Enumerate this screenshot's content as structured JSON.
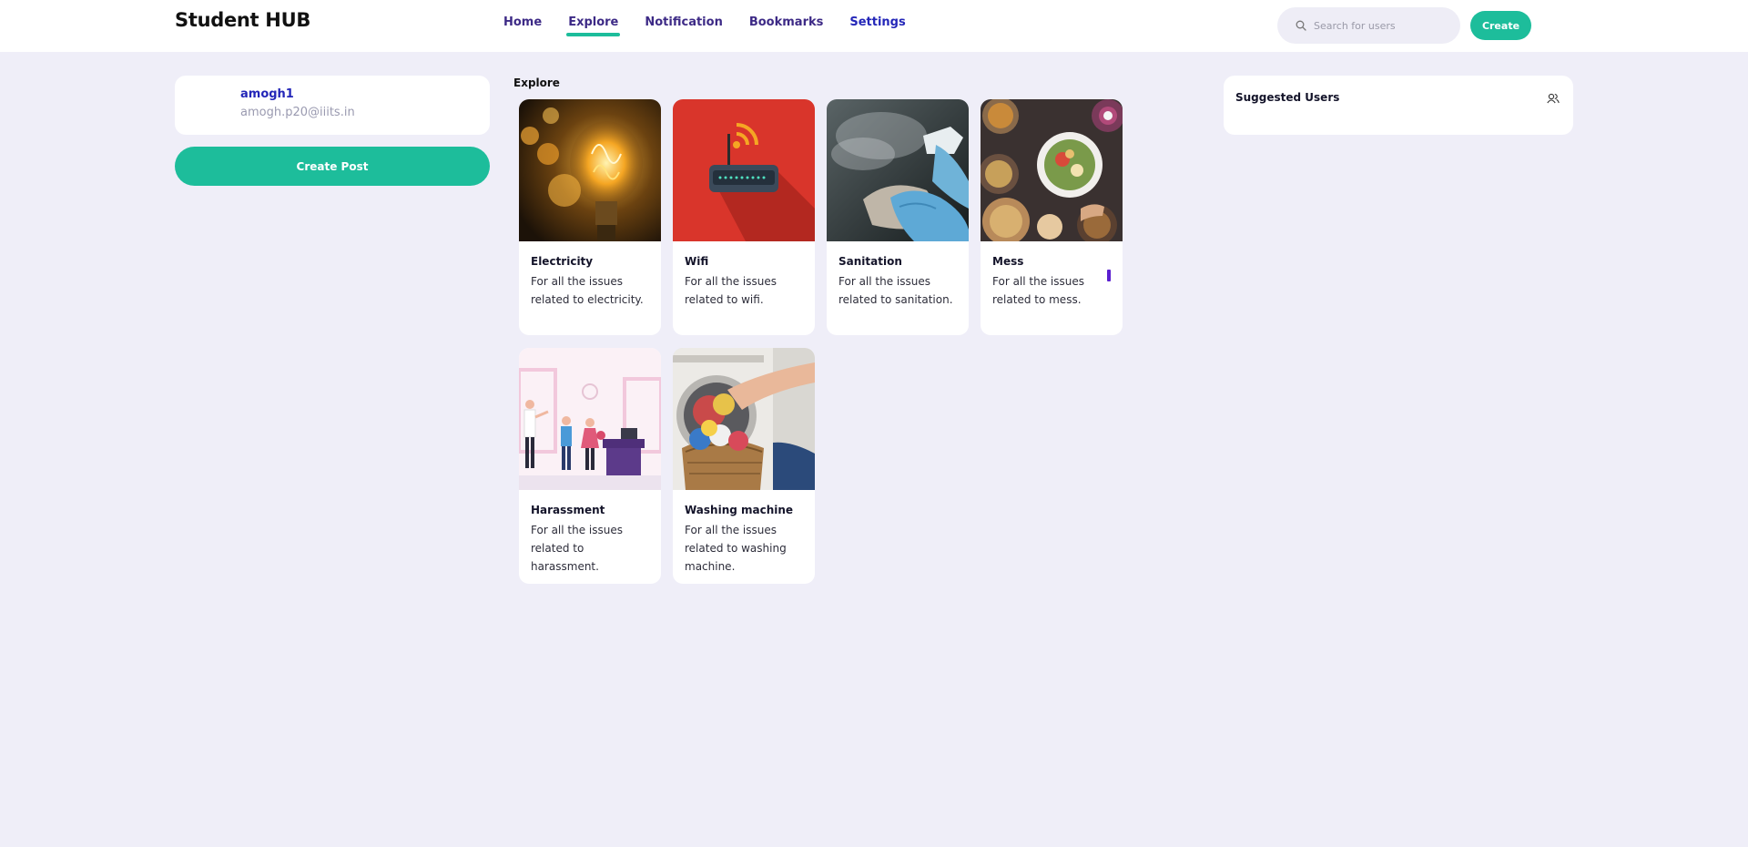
{
  "header": {
    "brand": "Student HUB",
    "nav": [
      "Home",
      "Explore",
      "Notification",
      "Bookmarks",
      "Settings"
    ],
    "active_nav": "Explore",
    "search_placeholder": "Search for users",
    "create_label": "Create"
  },
  "profile": {
    "username": "amogh1",
    "email": "amogh.p20@iiits.in"
  },
  "create_post_label": "Create Post",
  "explore": {
    "title": "Explore",
    "cards": [
      {
        "title": "Electricity",
        "desc": "For all the issues related to electricity.",
        "image": "light-bulb"
      },
      {
        "title": "Wifi",
        "desc": "For all the issues related to wifi.",
        "image": "router"
      },
      {
        "title": "Sanitation",
        "desc": "For all the issues related to sanitation.",
        "image": "spray-gloves"
      },
      {
        "title": "Mess",
        "desc": "For all the issues related to mess.",
        "image": "food-table"
      },
      {
        "title": "Harassment",
        "desc": "For all the issues related to harassment.",
        "image": "office-scene"
      },
      {
        "title": "Washing machine",
        "desc": "For all the issues related to washing machine.",
        "image": "laundry"
      }
    ]
  },
  "suggested": {
    "title": "Suggested Users",
    "icon": "users-icon"
  },
  "colors": {
    "accent": "#1dbd9b",
    "background": "#efeef8",
    "nav_text": "#3d2a86",
    "link_blue": "#2326b8"
  }
}
